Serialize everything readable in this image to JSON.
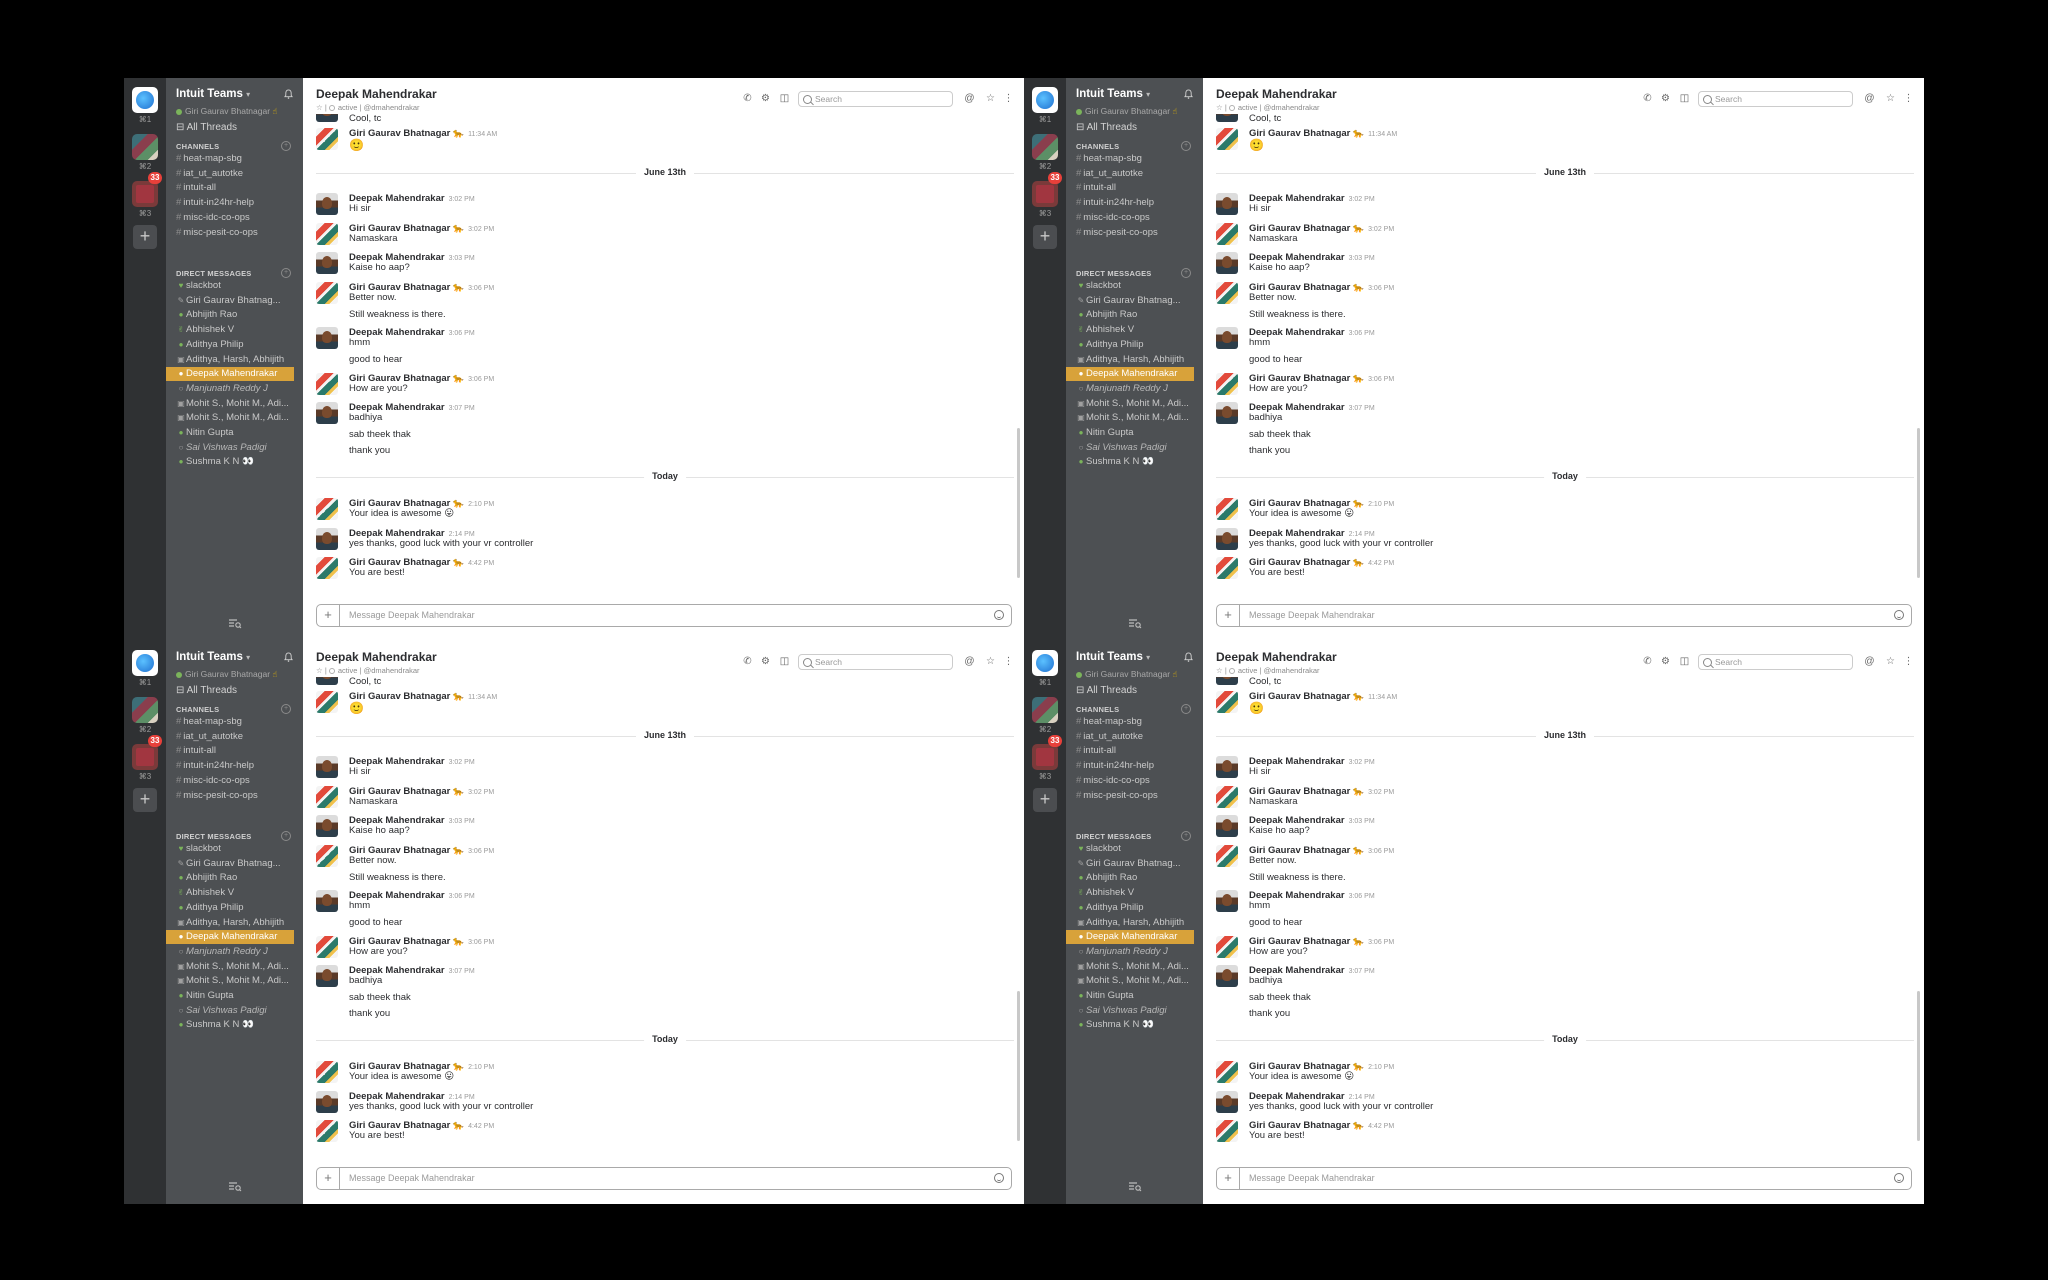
{
  "team_rail": {
    "shortcuts": [
      "⌘1",
      "⌘2",
      "⌘3"
    ],
    "badge": "33"
  },
  "sidebar": {
    "team_name": "Intuit Teams",
    "user": "Giri Gaurav Bhatnagar",
    "all_threads": "All Threads",
    "channels_header": "CHANNELS",
    "channels": [
      "heat-map-sbg",
      "iat_ut_autotke",
      "intuit-all",
      "intuit-in24hr-help",
      "misc-idc-co-ops",
      "misc-pesit-co-ops"
    ],
    "dm_header": "DIRECT MESSAGES",
    "dms": [
      {
        "name": "slackbot",
        "icon": "♥",
        "style": "normal"
      },
      {
        "name": "Giri Gaurav Bhatnag...",
        "icon": "✎",
        "style": "normal"
      },
      {
        "name": "Abhijith Rao",
        "icon": "●",
        "style": "normal"
      },
      {
        "name": "Abhishek V",
        "icon": "✌",
        "style": "normal"
      },
      {
        "name": "Adithya Philip",
        "icon": "●",
        "style": "normal"
      },
      {
        "name": "Adithya, Harsh, Abhijith",
        "icon": "▣",
        "style": "normal"
      },
      {
        "name": "Deepak Mahendrakar",
        "icon": "●",
        "style": "active"
      },
      {
        "name": "Manjunath Reddy J",
        "icon": "○",
        "style": "italic"
      },
      {
        "name": "Mohit S., Mohit M., Adi...",
        "icon": "▣",
        "style": "normal"
      },
      {
        "name": "Mohit S., Mohit M., Adi...",
        "icon": "▣",
        "style": "normal"
      },
      {
        "name": "Nitin Gupta",
        "icon": "●",
        "style": "normal"
      },
      {
        "name": "Sai Vishwas Padigi",
        "icon": "○",
        "style": "italic"
      },
      {
        "name": "Sushma K N 👀",
        "icon": "●",
        "style": "normal"
      }
    ]
  },
  "header": {
    "channel_name": "Deepak Mahendrakar",
    "status": "active",
    "handle": "@dmahendrakar",
    "search_placeholder": "Search"
  },
  "messages": {
    "top_partial": "Cool, tc",
    "first": {
      "author": "Giri Gaurav Bhatnagar",
      "time": "11:34 AM",
      "text": "🙂"
    },
    "june_divider": "June 13th",
    "june": [
      {
        "author": "Deepak Mahendrakar",
        "time": "3:02 PM",
        "lines": [
          "Hi sir"
        ],
        "who": "deepak"
      },
      {
        "author": "Giri Gaurav Bhatnagar",
        "time": "3:02 PM",
        "lines": [
          "Namaskara"
        ],
        "who": "giri"
      },
      {
        "author": "Deepak Mahendrakar",
        "time": "3:03 PM",
        "lines": [
          "Kaise ho aap?"
        ],
        "who": "deepak"
      },
      {
        "author": "Giri Gaurav Bhatnagar",
        "time": "3:06 PM",
        "lines": [
          "Better now.",
          "Still weakness is there."
        ],
        "who": "giri"
      },
      {
        "author": "Deepak Mahendrakar",
        "time": "3:06 PM",
        "lines": [
          "hmm",
          "good to hear"
        ],
        "who": "deepak"
      },
      {
        "author": "Giri Gaurav Bhatnagar",
        "time": "3:06 PM",
        "lines": [
          "How are you?"
        ],
        "who": "giri"
      },
      {
        "author": "Deepak Mahendrakar",
        "time": "3:07 PM",
        "lines": [
          "badhiya",
          "sab theek thak",
          "thank you"
        ],
        "who": "deepak"
      }
    ],
    "today_divider": "Today",
    "today": [
      {
        "author": "Giri Gaurav Bhatnagar",
        "time": "2:10 PM",
        "lines": [
          "Your idea is awesome 😛"
        ],
        "who": "giri"
      },
      {
        "author": "Deepak Mahendrakar",
        "time": "2:14 PM",
        "lines": [
          "yes thanks, good luck with your vr controller"
        ],
        "who": "deepak"
      },
      {
        "author": "Giri Gaurav Bhatnagar",
        "time": "4:42 PM",
        "lines": [
          "You are best!"
        ],
        "who": "giri"
      }
    ]
  },
  "composer": {
    "placeholder": "Message Deepak Mahendrakar"
  },
  "colors": {
    "sidebar": "#4d5053",
    "rail": "#2f3133",
    "active_item": "#d8a23a",
    "presence": "#7bb45b",
    "badge": "#e8403a"
  }
}
